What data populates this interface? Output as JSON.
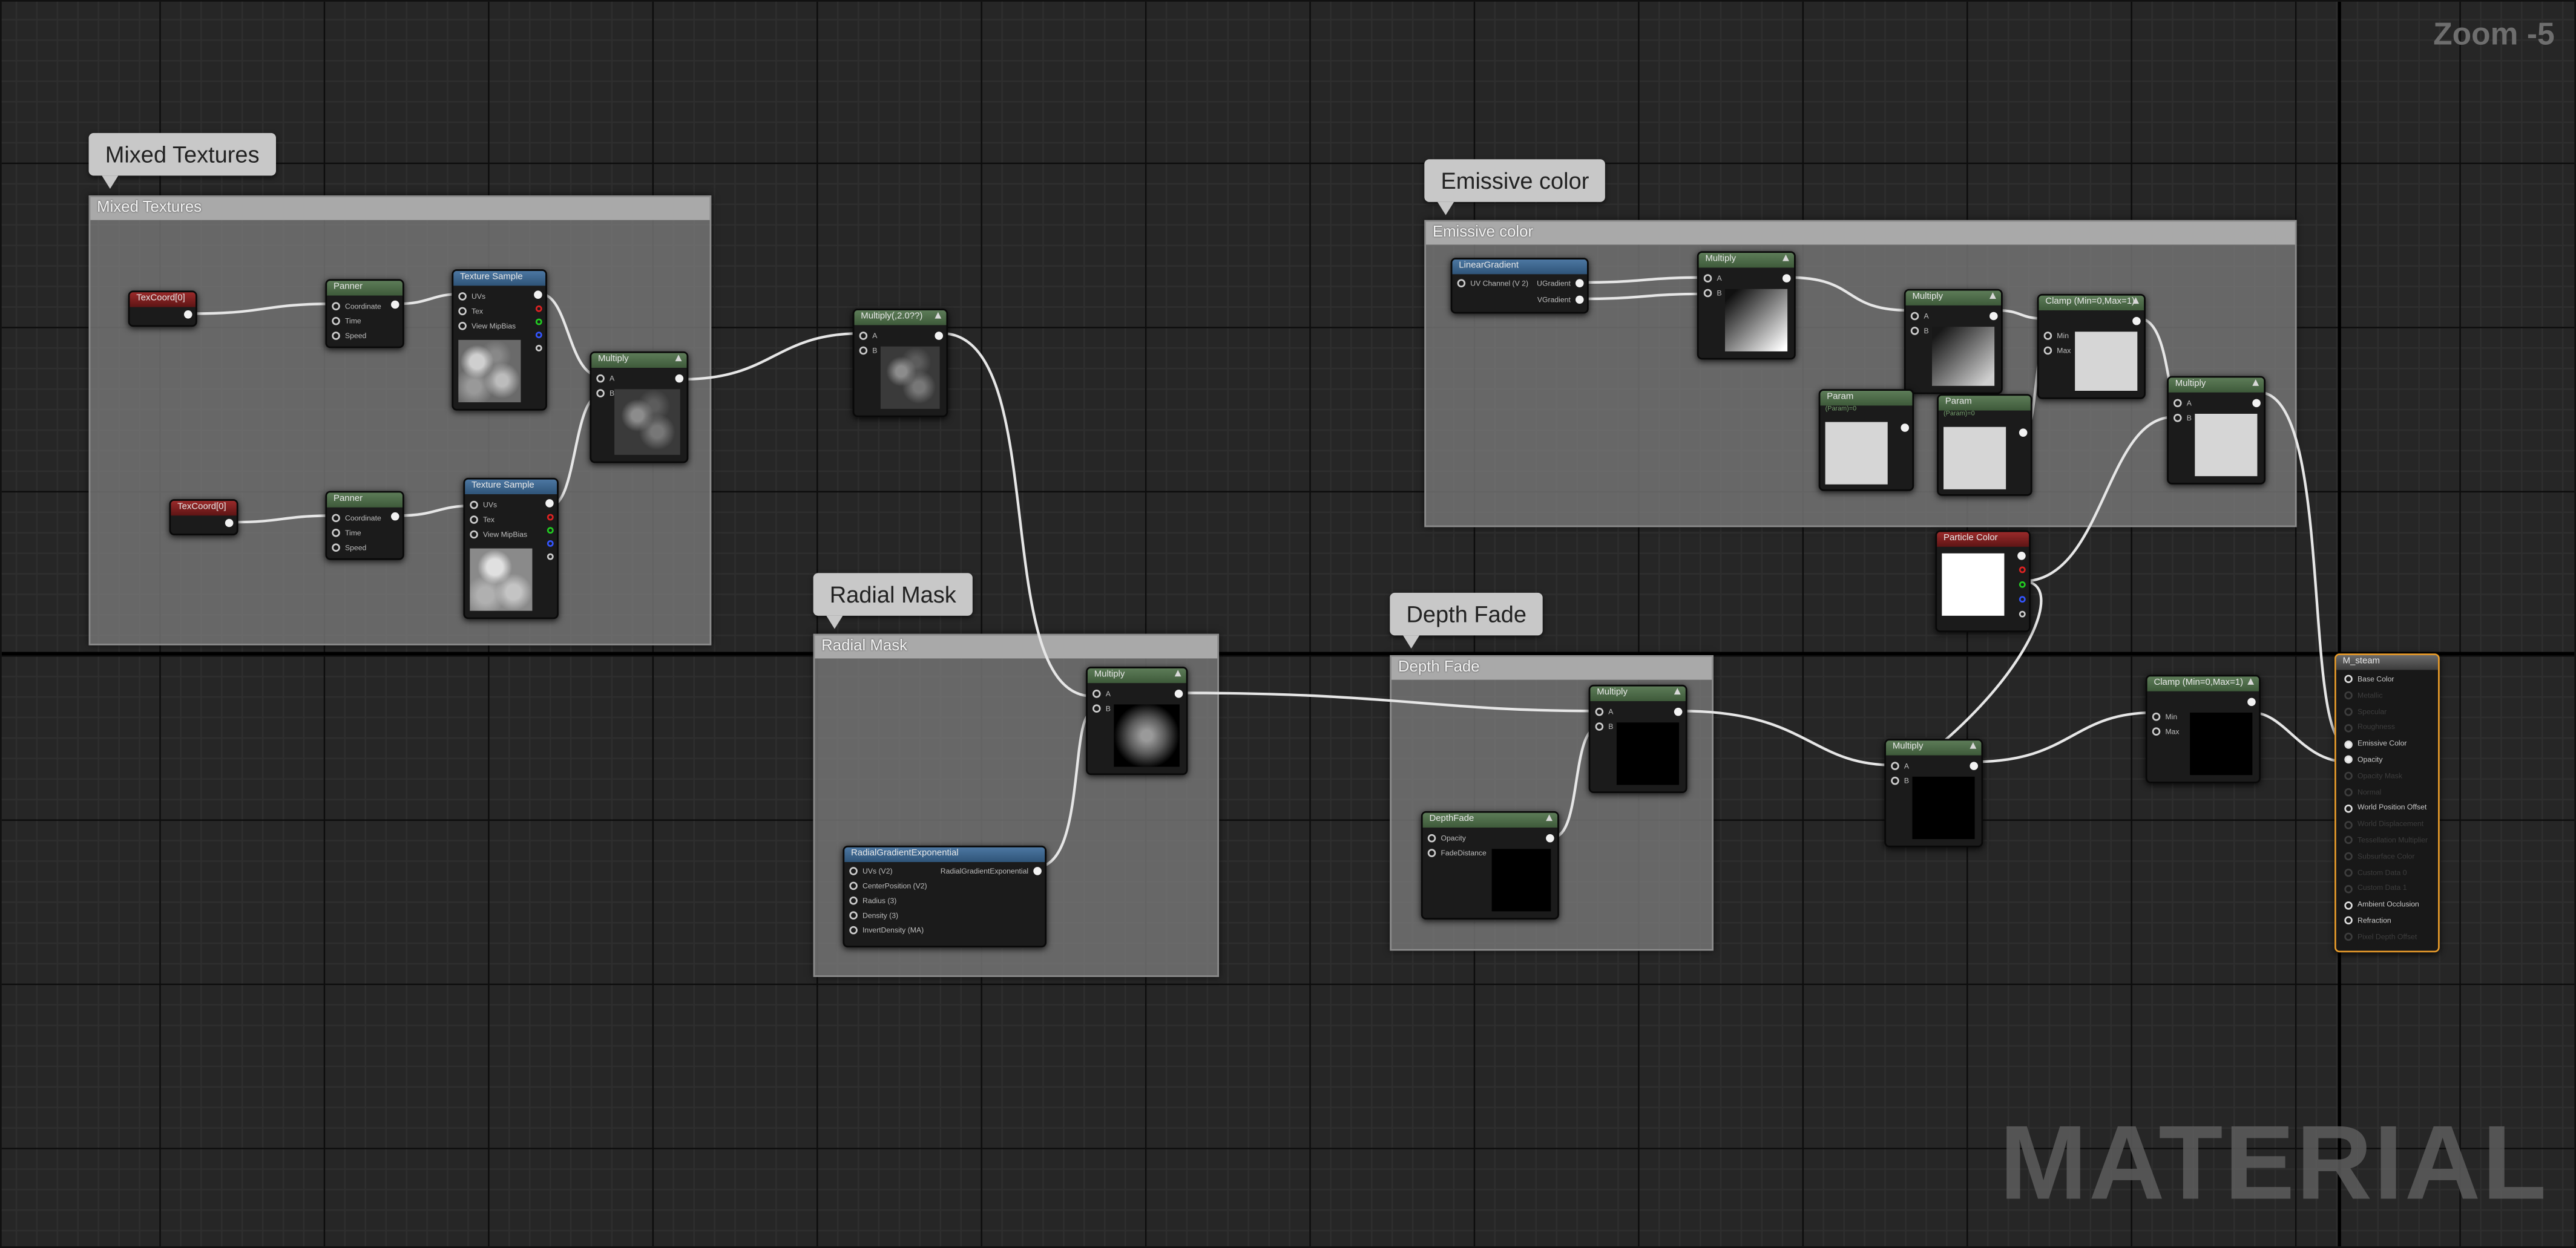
{
  "viewport": {
    "zoom_label": "Zoom -5",
    "watermark": "MATERIAL"
  },
  "comments": {
    "mixed_textures": {
      "bubble": "Mixed Textures",
      "title": "Mixed Textures"
    },
    "radial_mask": {
      "bubble": "Radial Mask",
      "title": "Radial Mask"
    },
    "emissive_color": {
      "bubble": "Emissive color",
      "title": "Emissive color"
    },
    "depth_fade": {
      "bubble": "Depth Fade",
      "title": "Depth Fade"
    }
  },
  "nodes": {
    "texcoord1": {
      "title": "TexCoord[0]"
    },
    "texcoord2": {
      "title": "TexCoord[0]"
    },
    "panner1": {
      "title": "Panner",
      "pins": [
        "Coordinate",
        "Time",
        "Speed"
      ]
    },
    "panner2": {
      "title": "Panner",
      "pins": [
        "Coordinate",
        "Time",
        "Speed"
      ]
    },
    "texsample1": {
      "title": "Texture Sample",
      "pins": [
        "UVs",
        "Tex",
        "View MipBias"
      ]
    },
    "texsample2": {
      "title": "Texture Sample",
      "pins": [
        "UVs",
        "Tex",
        "View MipBias"
      ]
    },
    "multiply_mix": {
      "title": "Multiply",
      "pins": [
        "A",
        "B"
      ]
    },
    "multiply_2": {
      "title": "Multiply(,2.0??)",
      "pins": [
        "A",
        "B"
      ]
    },
    "multiply_mask": {
      "title": "Multiply",
      "pins": [
        "A",
        "B"
      ]
    },
    "radial_gradient": {
      "title": "RadialGradientExponential",
      "output": "RadialGradientExponential",
      "pins": [
        "UVs (V2)",
        "CenterPosition (V2)",
        "Radius (3)",
        "Density (3)",
        "InvertDensity (MA)"
      ]
    },
    "linear_gradient": {
      "title": "LinearGradient",
      "pins": [
        "UV Channel (V 2)",
        "UGradient",
        "VGradient"
      ]
    },
    "multiply_e1": {
      "title": "Multiply",
      "pins": [
        "A",
        "B"
      ]
    },
    "multiply_e2": {
      "title": "Multiply",
      "pins": [
        "A",
        "B"
      ]
    },
    "clamp_e": {
      "title": "Clamp (Min=0,Max=1)",
      "pins": [
        "Min",
        "Max"
      ]
    },
    "param1": {
      "title": "Param",
      "sub": "(Param)=0"
    },
    "param2": {
      "title": "Param",
      "sub": "(Param)=0"
    },
    "multiply_e3": {
      "title": "Multiply",
      "pins": [
        "A",
        "B"
      ]
    },
    "particle_color": {
      "title": "Particle Color"
    },
    "multiply_depth": {
      "title": "Multiply",
      "pins": [
        "A",
        "B"
      ]
    },
    "depth_fade": {
      "title": "DepthFade",
      "pins": [
        "Opacity",
        "FadeDistance"
      ]
    },
    "multiply_final": {
      "title": "Multiply",
      "pins": [
        "A",
        "B"
      ]
    },
    "clamp_final": {
      "title": "Clamp (Min=0,Max=1)",
      "pins": [
        "Min",
        "Max"
      ]
    }
  },
  "result_node": {
    "title": "M_steam",
    "pins": [
      {
        "label": "Base Color",
        "active": true
      },
      {
        "label": "Metallic",
        "active": false
      },
      {
        "label": "Specular",
        "active": false
      },
      {
        "label": "Roughness",
        "active": false
      },
      {
        "label": "Emissive Color",
        "active": true,
        "connected": true
      },
      {
        "label": "Opacity",
        "active": true,
        "connected": true
      },
      {
        "label": "Opacity Mask",
        "active": false
      },
      {
        "label": "Normal",
        "active": false
      },
      {
        "label": "World Position Offset",
        "active": true
      },
      {
        "label": "World Displacement",
        "active": false
      },
      {
        "label": "Tessellation Multiplier",
        "active": false
      },
      {
        "label": "Subsurface Color",
        "active": false
      },
      {
        "label": "Custom Data 0",
        "active": false
      },
      {
        "label": "Custom Data 1",
        "active": false
      },
      {
        "label": "Ambient Occlusion",
        "active": true
      },
      {
        "label": "Refraction",
        "active": true
      },
      {
        "label": "Pixel Depth Offset",
        "active": false
      }
    ]
  },
  "colors": {
    "background": "#262626",
    "selected_border": "#e79b2b",
    "wire": "#e6e6e6"
  }
}
